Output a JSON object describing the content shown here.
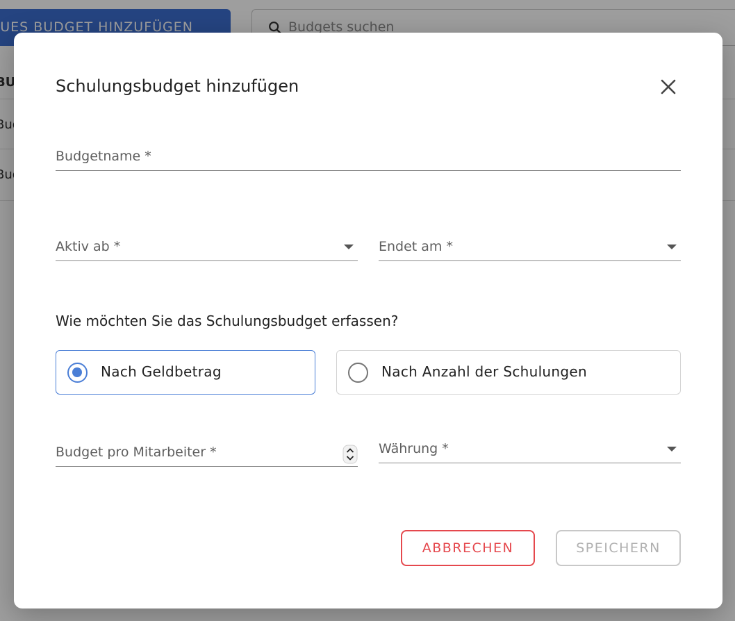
{
  "background": {
    "add_button_label": "NEUES BUDGET HINZUFÜGEN",
    "search_placeholder": "Budgets suchen",
    "rows": [
      "BUD",
      "Bud",
      "Bud"
    ]
  },
  "dialog": {
    "title": "Schulungsbudget hinzufügen",
    "close_icon": "close-icon",
    "fields": {
      "budget_name": "Budgetname *",
      "active_from": "Aktiv ab *",
      "ends_on": "Endet am *",
      "budget_per_employee": "Budget pro Mitarbeiter *",
      "currency": "Währung *"
    },
    "question": "Wie möchten Sie das Schulungsbudget erfassen?",
    "options": [
      {
        "label": "Nach Geldbetrag",
        "selected": true
      },
      {
        "label": "Nach Anzahl der Schulungen",
        "selected": false
      }
    ],
    "buttons": {
      "cancel": "ABBRECHEN",
      "save": "SPEICHERN"
    }
  },
  "colors": {
    "primary": "#4a7ed6",
    "danger": "#e5484d",
    "disabled": "#b0b0b0",
    "background_button": "#3d6fd1"
  }
}
